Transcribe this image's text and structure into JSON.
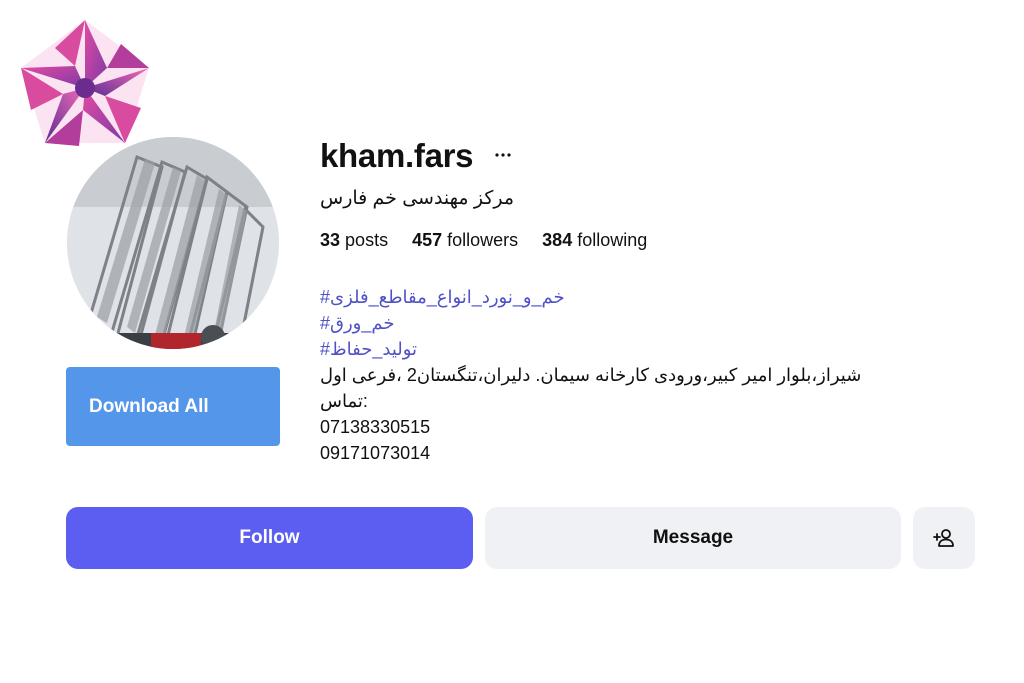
{
  "profile": {
    "username": "kham.fars",
    "full_name": "مرکز مهندسی خم فارس",
    "stats": {
      "posts_count": "33",
      "posts_label": "posts",
      "followers_count": "457",
      "followers_label": "followers",
      "following_count": "384",
      "following_label": "following"
    },
    "bio": {
      "hashtags": [
        "#خم_و_نورد_انواع_مقاطع_فلزی",
        "#خم_ورق",
        "#تولید_حفاظ"
      ],
      "lines": [
        "شیراز،بلوار امیر کبیر،ورودی کارخانه سیمان. دلیران،تنگستان2 ،فرعی اول",
        "تماس:",
        "07138330515",
        "09171073014"
      ]
    }
  },
  "actions": {
    "download_label": "Download All",
    "follow_label": "Follow",
    "message_label": "Message"
  },
  "icons": {
    "more": "more-icon",
    "add_user": "add-user-icon",
    "logo": "logo-icon"
  },
  "colors": {
    "follow": "#5b5ef0",
    "download": "#5496ea",
    "hashtag": "#4f51c7",
    "message_bg": "#eff1f5"
  }
}
